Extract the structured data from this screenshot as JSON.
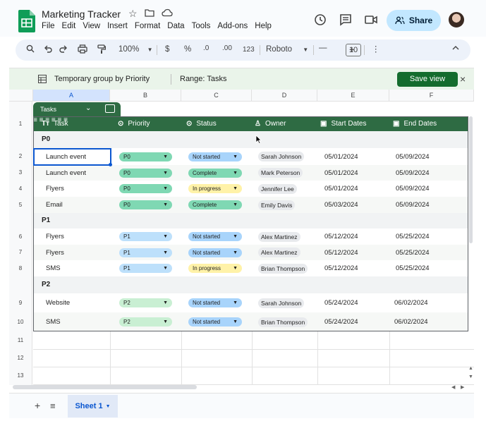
{
  "app": {
    "title": "Marketing Tracker",
    "menu": [
      "File",
      "Edit",
      "View",
      "Insert",
      "Format",
      "Data",
      "Tools",
      "Add-ons",
      "Help"
    ],
    "share_label": "Share"
  },
  "toolbar": {
    "zoom": "100%",
    "currency": "$",
    "percent": "%",
    "dec_decrease": ".0",
    "dec_increase": ".00",
    "number_format": "123",
    "font": "Roboto",
    "font_size": "10",
    "minus": "—",
    "plus": "+"
  },
  "banner": {
    "group_text": "Temporary group by Priority",
    "range_text": "Range: Tasks",
    "save_view": "Save view",
    "close": "×"
  },
  "columns": [
    "A",
    "B",
    "C",
    "D",
    "E",
    "F"
  ],
  "row_numbers": [
    "1",
    "2",
    "3",
    "4",
    "5",
    "6",
    "7",
    "8",
    "9",
    "10",
    "11",
    "12",
    "13"
  ],
  "table": {
    "name": "Tasks",
    "headers": [
      "Task",
      "Priority",
      "Status",
      "Owner",
      "Start Dates",
      "End Dates"
    ],
    "groups": [
      {
        "label": "P0",
        "rows": [
          {
            "task": "Launch event",
            "priority": "P0",
            "status": "Not started",
            "owner": "Sarah Johnson",
            "start": "05/01/2024",
            "end": "05/09/2024"
          },
          {
            "task": "Launch event",
            "priority": "P0",
            "status": "Complete",
            "owner": "Mark Peterson",
            "start": "05/01/2024",
            "end": "05/09/2024"
          },
          {
            "task": "Flyers",
            "priority": "P0",
            "status": "In progress",
            "owner": "Jennifer Lee",
            "start": "05/01/2024",
            "end": "05/09/2024"
          },
          {
            "task": "Email",
            "priority": "P0",
            "status": "Complete",
            "owner": "Emily Davis",
            "start": "05/03/2024",
            "end": "05/09/2024"
          }
        ]
      },
      {
        "label": "P1",
        "rows": [
          {
            "task": "Flyers",
            "priority": "P1",
            "status": "Not started",
            "owner": "Alex Martinez",
            "start": "05/12/2024",
            "end": "05/25/2024"
          },
          {
            "task": "Flyers",
            "priority": "P1",
            "status": "Not started",
            "owner": "Alex Martinez",
            "start": "05/12/2024",
            "end": "05/25/2024"
          },
          {
            "task": "SMS",
            "priority": "P1",
            "status": "In progress",
            "owner": "Brian Thompson",
            "start": "05/12/2024",
            "end": "05/25/2024"
          }
        ]
      },
      {
        "label": "P2",
        "rows": [
          {
            "task": "Website",
            "priority": "P2",
            "status": "Not started",
            "owner": "Sarah Johnson",
            "start": "05/24/2024",
            "end": "06/02/2024"
          },
          {
            "task": "SMS",
            "priority": "P2",
            "status": "Not started",
            "owner": "Brian Thompson",
            "start": "05/24/2024",
            "end": "06/02/2024"
          }
        ]
      }
    ]
  },
  "colors": {
    "P0": "#7fd8b3",
    "P1": "#bde0fb",
    "P2": "#c9efd3",
    "Not started": "#a8d4fb",
    "Complete": "#7fd8b3",
    "In progress": "#fff2a8",
    "table_header": "#2e6b43",
    "accent": "#0b57d0"
  },
  "sheets": {
    "active": "Sheet 1",
    "add": "+",
    "all": "≡"
  }
}
